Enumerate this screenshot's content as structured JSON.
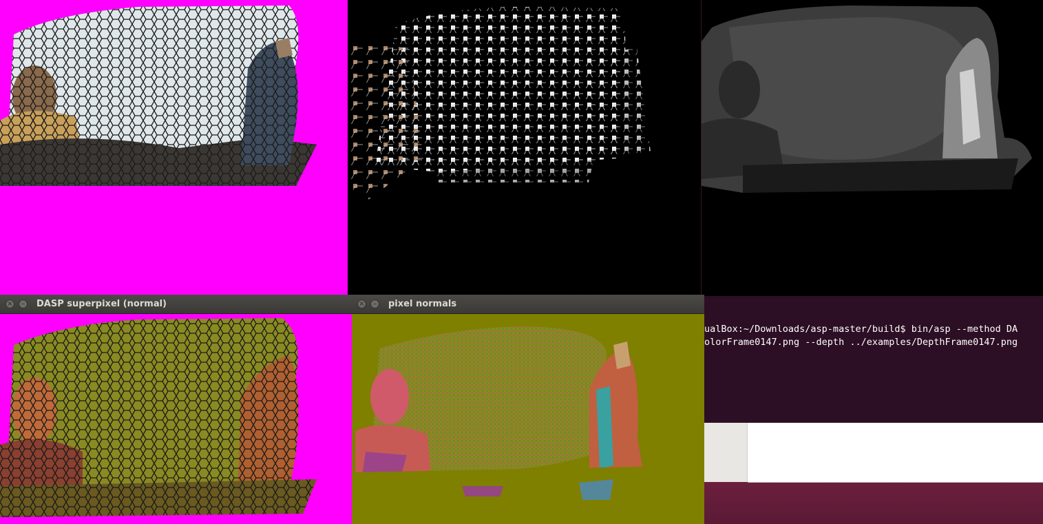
{
  "windows": {
    "superpixel_labels": {
      "title": ""
    },
    "superpixel_graph": {
      "title": ""
    },
    "depth": {
      "title": ""
    },
    "dasp_normal": {
      "title": "DASP superpixel (normal)"
    },
    "pixel_normals": {
      "title": "pixel normals"
    }
  },
  "terminal": {
    "line1": "ualBox:~/Downloads/asp-master/build$ bin/asp --method DA",
    "line2": "olorFrame0147.png --depth ../examples/DepthFrame0147.png"
  },
  "icons": {
    "close": "close-icon",
    "minimize": "minimize-icon"
  },
  "colors": {
    "mask_magenta": "#ff00ff",
    "normal_olive": "#7f7f00",
    "terminal_bg": "#2c0f24",
    "desktop_bg": "#7a2444"
  }
}
